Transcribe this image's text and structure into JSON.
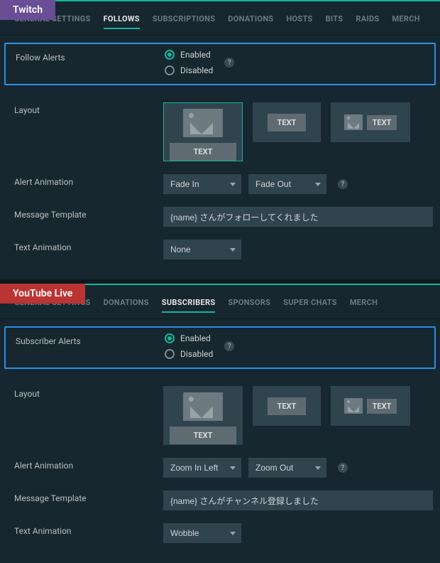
{
  "twitch": {
    "badge": "Twitch",
    "tabs": [
      "GENERAL SETTINGS",
      "FOLLOWS",
      "SUBSCRIPTIONS",
      "DONATIONS",
      "HOSTS",
      "BITS",
      "RAIDS",
      "MERCH"
    ],
    "active_tab": 1,
    "alerts_label": "Follow Alerts",
    "enabled": "Enabled",
    "disabled": "Disabled",
    "layout_label": "Layout",
    "layout_text": "TEXT",
    "animation_label": "Alert Animation",
    "anim_in": "Fade In",
    "anim_out": "Fade Out",
    "msg_label": "Message Template",
    "msg_value": "{name} さんがフォローしてくれました",
    "textanim_label": "Text Animation",
    "textanim_value": "None"
  },
  "youtube": {
    "badge": "YouTube Live",
    "tabs": [
      "GENERAL SETTINGS",
      "DONATIONS",
      "SUBSCRIBERS",
      "SPONSORS",
      "SUPER CHATS",
      "MERCH"
    ],
    "active_tab": 2,
    "alerts_label": "Subscriber Alerts",
    "enabled": "Enabled",
    "disabled": "Disabled",
    "layout_label": "Layout",
    "layout_text": "TEXT",
    "animation_label": "Alert Animation",
    "anim_in": "Zoom In Left",
    "anim_out": "Zoom Out",
    "msg_label": "Message Template",
    "msg_value": "{name} さんがチャンネル登録しました",
    "textanim_label": "Text Animation",
    "textanim_value": "Wobble"
  }
}
